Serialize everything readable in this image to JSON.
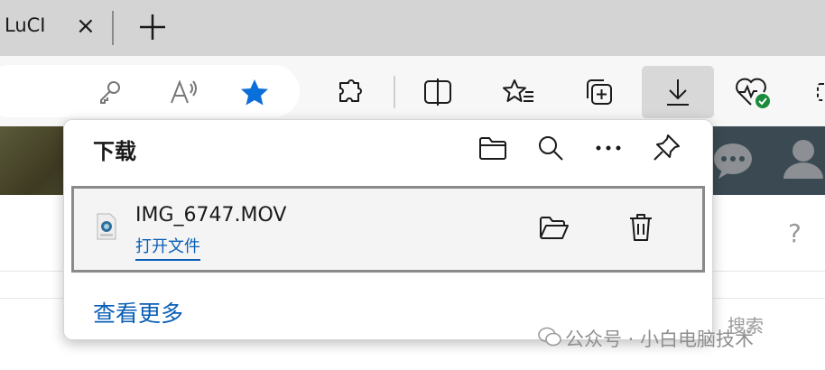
{
  "tab": {
    "title": "LuCI",
    "close_glyph": "×",
    "new_tab_glyph": "+"
  },
  "toolbar": {
    "icons": [
      "key-icon",
      "read-aloud-icon",
      "favorite-star-icon",
      "extensions-icon",
      "split-screen-icon",
      "favorites-icon",
      "collections-icon",
      "downloads-icon",
      "browser-essentials-icon"
    ]
  },
  "downloads": {
    "title": "下载",
    "header_icons": [
      "open-folder-icon",
      "search-icon",
      "more-icon",
      "pin-icon"
    ],
    "items": [
      {
        "file_name": "IMG_6747.MOV",
        "action_label": "打开文件"
      }
    ],
    "see_more": "查看更多"
  },
  "page": {
    "help_glyph": "?"
  },
  "watermark": {
    "text": "公众号 · 小白电脑技术",
    "search_text": "搜索"
  },
  "colors": {
    "accent": "#0a5eb5",
    "star": "#0a6fd8",
    "check_green": "#1a8a3c"
  }
}
